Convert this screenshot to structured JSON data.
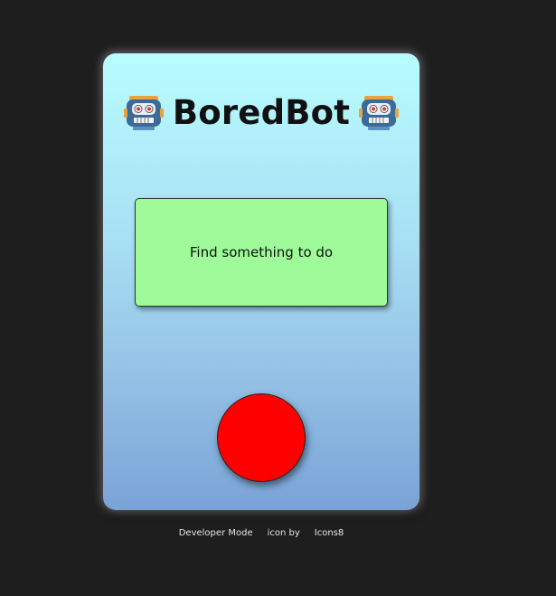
{
  "app": {
    "title": "BoredBot",
    "title_icon_left": "robot-icon",
    "title_icon_right": "robot-icon"
  },
  "main": {
    "action_label": "Find something to do",
    "round_button_color": "#ff0000",
    "action_button_color": "#9ffb99"
  },
  "footer": {
    "developer_mode": "Developer Mode",
    "icon_by": "icon by",
    "icons8": "Icons8"
  },
  "colors": {
    "background": "#1e1e1e",
    "card_top": "#b8fdff",
    "card_bottom": "#7aa3d6"
  }
}
